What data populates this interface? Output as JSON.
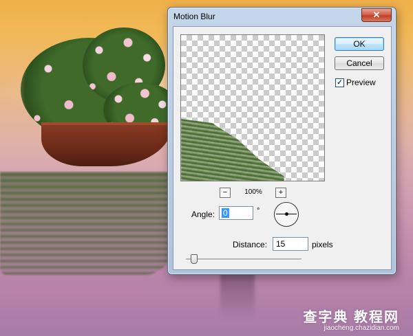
{
  "dialog": {
    "title": "Motion Blur",
    "close_glyph": "✕",
    "ok_label": "OK",
    "cancel_label": "Cancel",
    "preview_label": "Preview",
    "preview_checked": true,
    "preview_check_glyph": "✓",
    "zoom_out_glyph": "−",
    "zoom_in_glyph": "+",
    "zoom_level": "100%",
    "angle_label": "Angle:",
    "angle_value": "0",
    "degree_symbol": "°",
    "distance_label": "Distance:",
    "distance_value": "15",
    "distance_unit": "pixels",
    "distance_slider_fraction": 0.04
  },
  "watermark": {
    "main": "查字典 教程网",
    "sub": "jiaocheng.chazidian.com"
  },
  "colors": {
    "title_bar": "#bcd0e8",
    "close_button": "#c94f36",
    "ok_button_border": "#3c7fb1",
    "selection": "#3399ff"
  },
  "icons": {
    "close": "close-icon",
    "zoom_out": "zoom-out-icon",
    "zoom_in": "zoom-in-icon",
    "angle_dial": "angle-dial-icon",
    "checkbox": "checkbox-icon"
  }
}
